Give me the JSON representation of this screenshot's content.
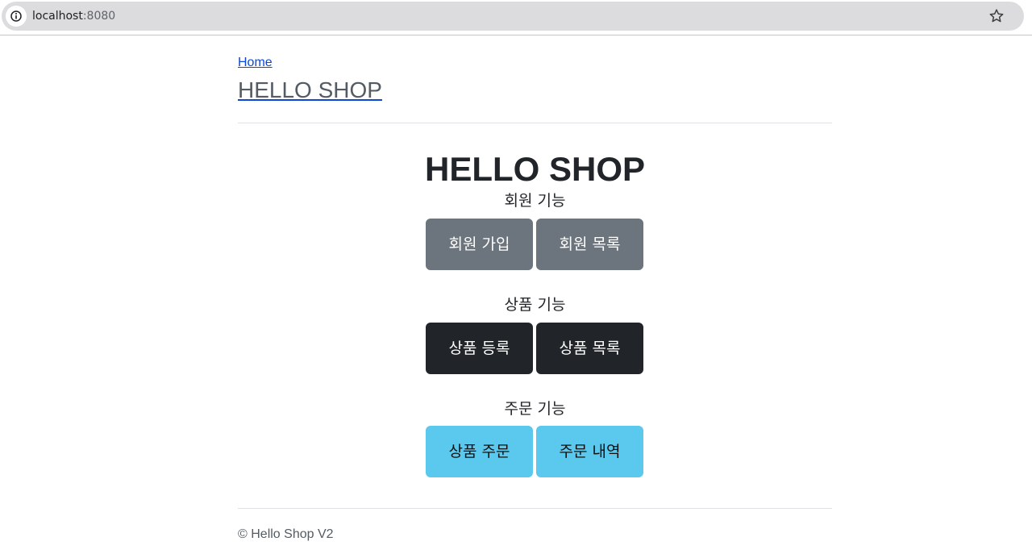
{
  "browser": {
    "url_host": "localhost",
    "url_port": ":8080",
    "site_info_icon": "info-icon",
    "bookmark_icon": "star-icon"
  },
  "header": {
    "breadcrumb_home": "Home",
    "brand": "HELLO SHOP"
  },
  "main": {
    "title": "HELLO SHOP",
    "sections": [
      {
        "label": "회원 기능",
        "buttons": [
          "회원 가입",
          "회원 목록"
        ],
        "style": "secondary",
        "color": "#6c757d"
      },
      {
        "label": "상품 기능",
        "buttons": [
          "상품 등록",
          "상품 목록"
        ],
        "style": "dark",
        "color": "#212529"
      },
      {
        "label": "주문 기능",
        "buttons": [
          "상품 주문",
          "주문 내역"
        ],
        "style": "info",
        "color": "#5bc8ee"
      }
    ]
  },
  "footer": {
    "text": "© Hello Shop V2"
  },
  "colors": {
    "link": "#0d47d9",
    "muted_text": "#545b62",
    "divider": "#dee2e6"
  }
}
